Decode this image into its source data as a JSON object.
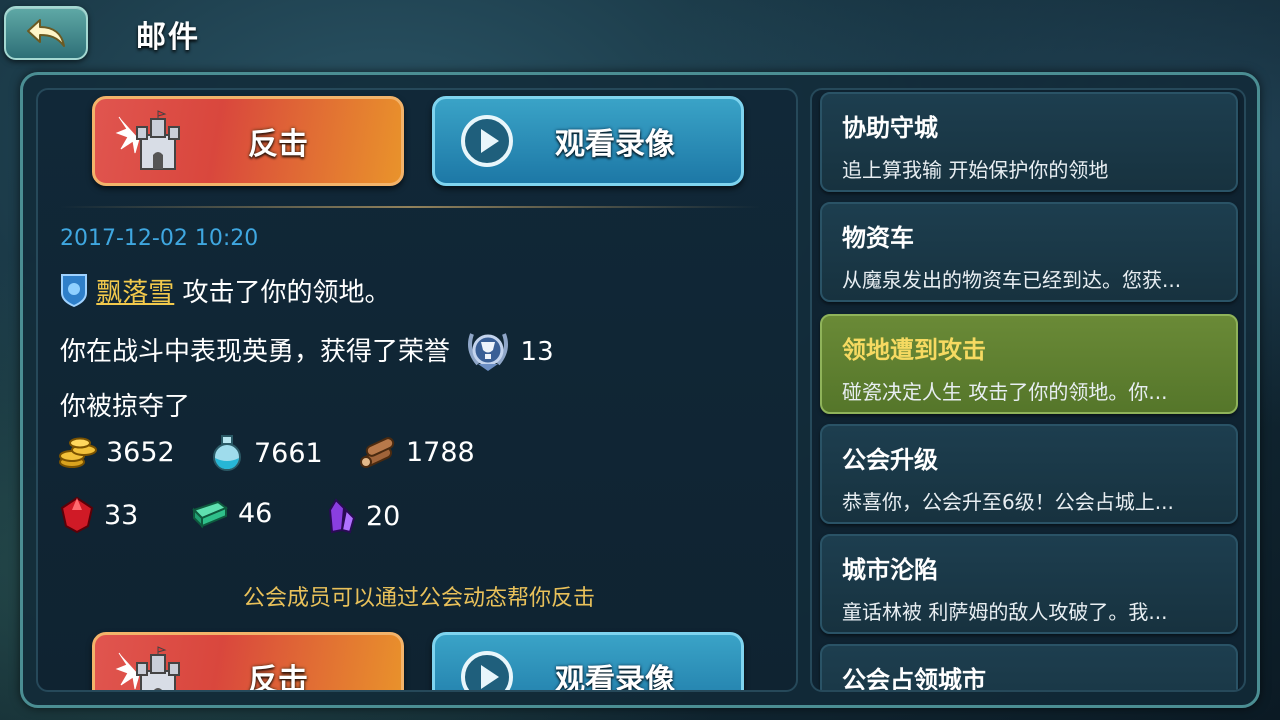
{
  "header": {
    "title": "邮件"
  },
  "actions": {
    "counter_label": "反击",
    "replay_label": "观看录像"
  },
  "mail": {
    "timestamp": "2017-12-02 10:20",
    "attacker_name": "飘落雪",
    "attack_text": "攻击了你的领地。",
    "honor_text": "你在战斗中表现英勇，获得了荣誉",
    "honor_value": "13",
    "plunder_text": "你被掠夺了",
    "resources": [
      {
        "icon": "gold-coins-icon",
        "value": "3652"
      },
      {
        "icon": "potion-icon",
        "value": "7661"
      },
      {
        "icon": "wood-icon",
        "value": "1788"
      },
      {
        "icon": "ruby-icon",
        "value": "33"
      },
      {
        "icon": "emerald-bar-icon",
        "value": "46"
      },
      {
        "icon": "purple-crystal-icon",
        "value": "20"
      }
    ],
    "hint": "公会成员可以通过公会动态帮你反击"
  },
  "mail_list": [
    {
      "title": "协助守城",
      "preview": "追上算我输 开始保护你的领地"
    },
    {
      "title": "物资车",
      "preview": "从魔泉发出的物资车已经到达。您获..."
    },
    {
      "title": "领地遭到攻击",
      "preview": "碰瓷决定人生 攻击了你的领地。你..."
    },
    {
      "title": "公会升级",
      "preview": "恭喜你，公会升至6级！公会占城上..."
    },
    {
      "title": "城市沦陷",
      "preview": "童话林被 利萨姆的敌人攻破了。我..."
    },
    {
      "title": "公会占领城市",
      "preview": ""
    }
  ],
  "colors": {
    "timestamp": "#3fa7e0",
    "player_name": "#f2c94c",
    "hint": "#e9c15a",
    "selected_item": "#5f8032"
  }
}
